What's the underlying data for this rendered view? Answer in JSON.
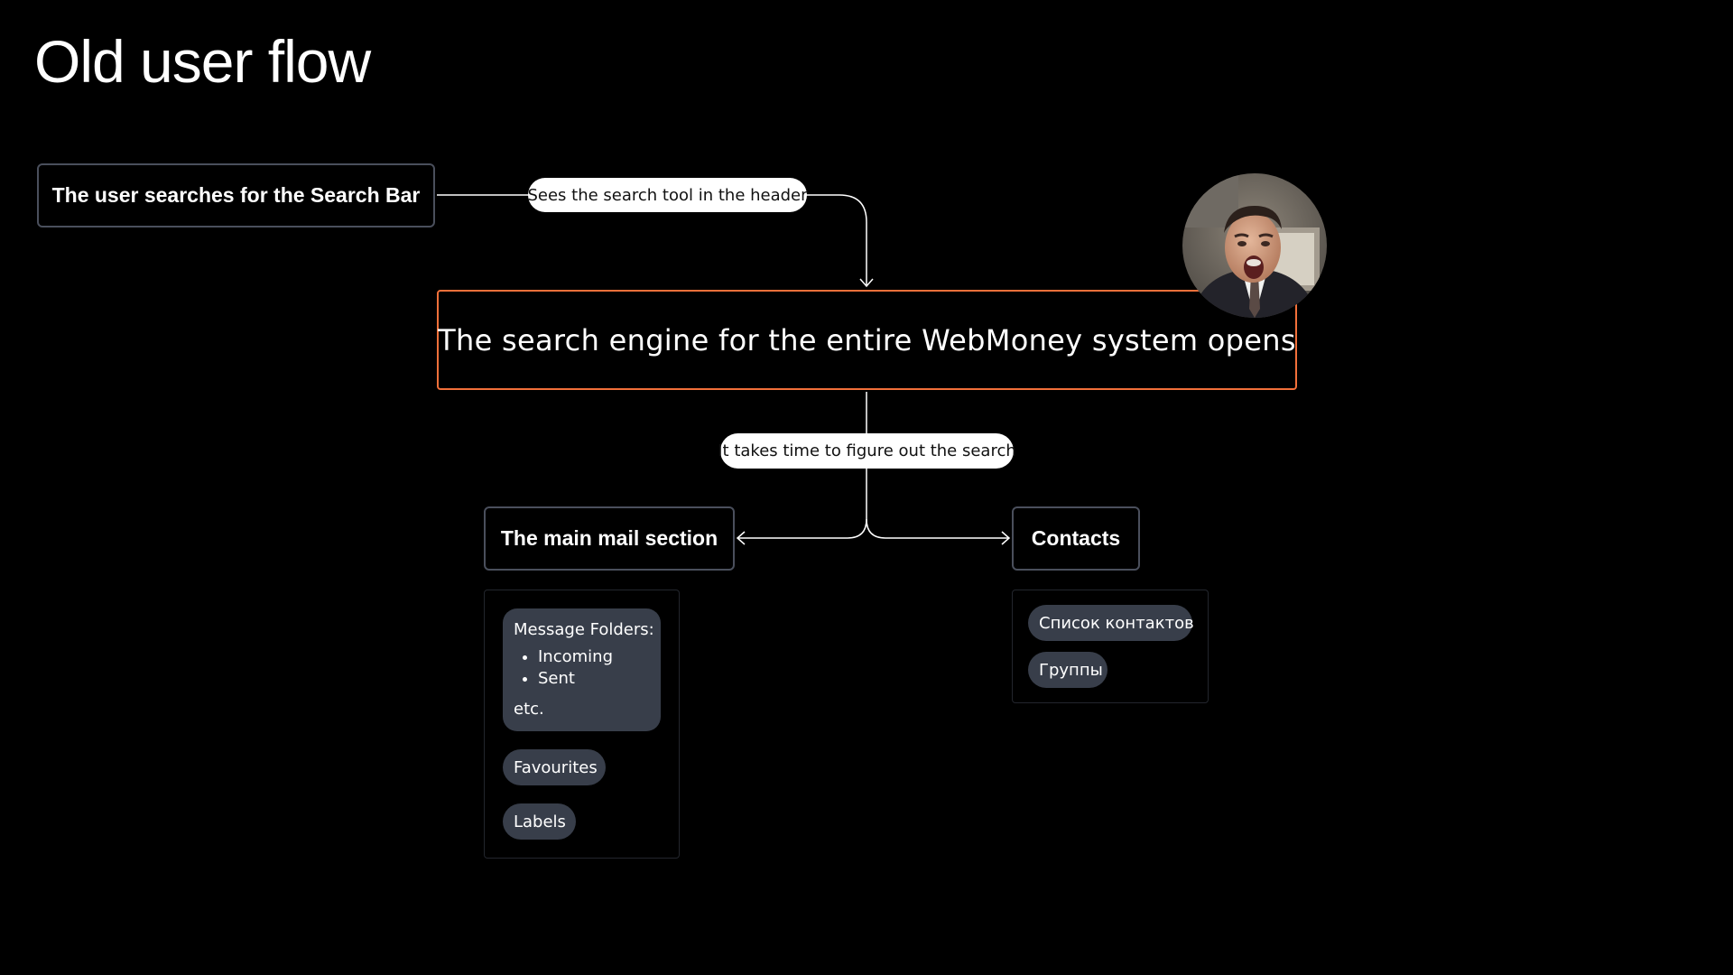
{
  "title": "Old user flow",
  "nodes": {
    "start": "The user searches for the Search Bar",
    "engine": "The search engine for the entire WebMoney system opens",
    "mail": "The main mail section",
    "contacts": "Contacts"
  },
  "edge_labels": {
    "header": "Sees the search tool in the header",
    "figure_out": "It takes time to figure out the search"
  },
  "mail_section": {
    "folders_title": "Message Folders:",
    "folders": [
      "Incoming",
      "Sent"
    ],
    "folders_etc": "etc.",
    "favourites": "Favourites",
    "labels": "Labels"
  },
  "contacts_section": {
    "list": "Список контактов",
    "groups": "Группы"
  },
  "colors": {
    "background": "#000000",
    "highlight_border": "#f2703a",
    "node_border": "#4a4f5c",
    "chip_bg": "#383e4a"
  },
  "avatar": {
    "icon": "surprised-man-photo"
  }
}
